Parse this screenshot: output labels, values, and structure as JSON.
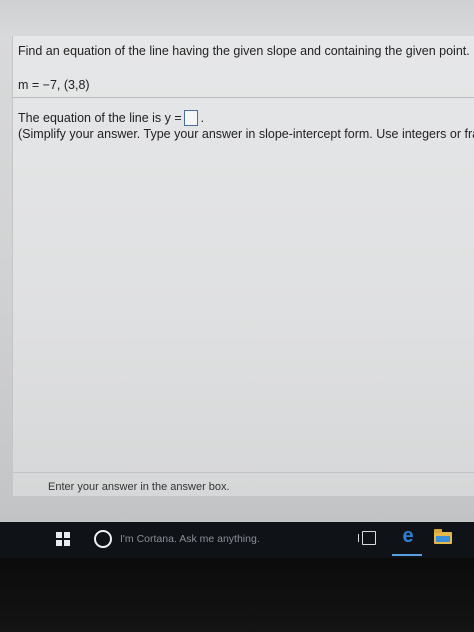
{
  "problem": {
    "question": "Find an equation of the line having the given slope and containing the given point.",
    "parameters": "m = −7, (3,8)",
    "answer_prefix": "The equation of the line is y =",
    "answer_suffix": ".",
    "hint": "(Simplify your answer. Type your answer in slope-intercept form. Use integers or fracti"
  },
  "footer": {
    "message": "Enter your answer in the answer box."
  },
  "taskbar": {
    "cortana_placeholder": "I'm Cortana. Ask me anything."
  },
  "icons": {
    "start": "windows-logo-icon",
    "cortana": "cortana-circle-icon",
    "task_view": "task-view-icon",
    "edge": "edge-browser-icon",
    "explorer": "file-explorer-icon"
  },
  "colors": {
    "answer_box_border": "#4a6fa5",
    "taskbar": "#0f1216",
    "edge_blue": "#2f7fd8"
  }
}
